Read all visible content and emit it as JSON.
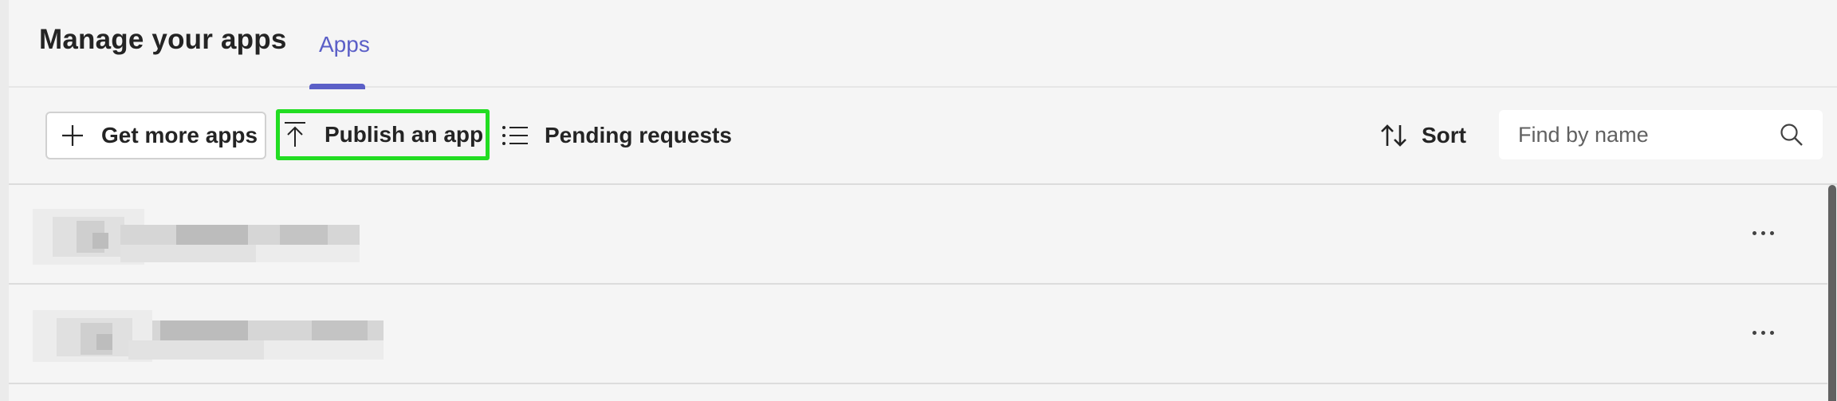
{
  "header": {
    "title": "Manage your apps",
    "tabs": [
      {
        "label": "Apps",
        "active": true
      }
    ],
    "accent_color": "#5b5fc7"
  },
  "toolbar": {
    "get_more_apps": {
      "label": "Get more apps",
      "icon": "plus-icon"
    },
    "publish_app": {
      "label": "Publish an app",
      "icon": "upload-icon",
      "highlight_color": "#22dd22"
    },
    "pending_requests": {
      "label": "Pending requests",
      "icon": "list-icon"
    },
    "sort": {
      "label": "Sort",
      "icon": "sort-arrows-icon"
    },
    "search": {
      "placeholder": "Find by name",
      "value": "",
      "icon": "search-icon"
    }
  },
  "apps_list": {
    "rows": [
      {
        "name": "",
        "redacted": true,
        "more_icon": "more-options-icon"
      },
      {
        "name": "",
        "redacted": true,
        "more_icon": "more-options-icon"
      }
    ]
  }
}
